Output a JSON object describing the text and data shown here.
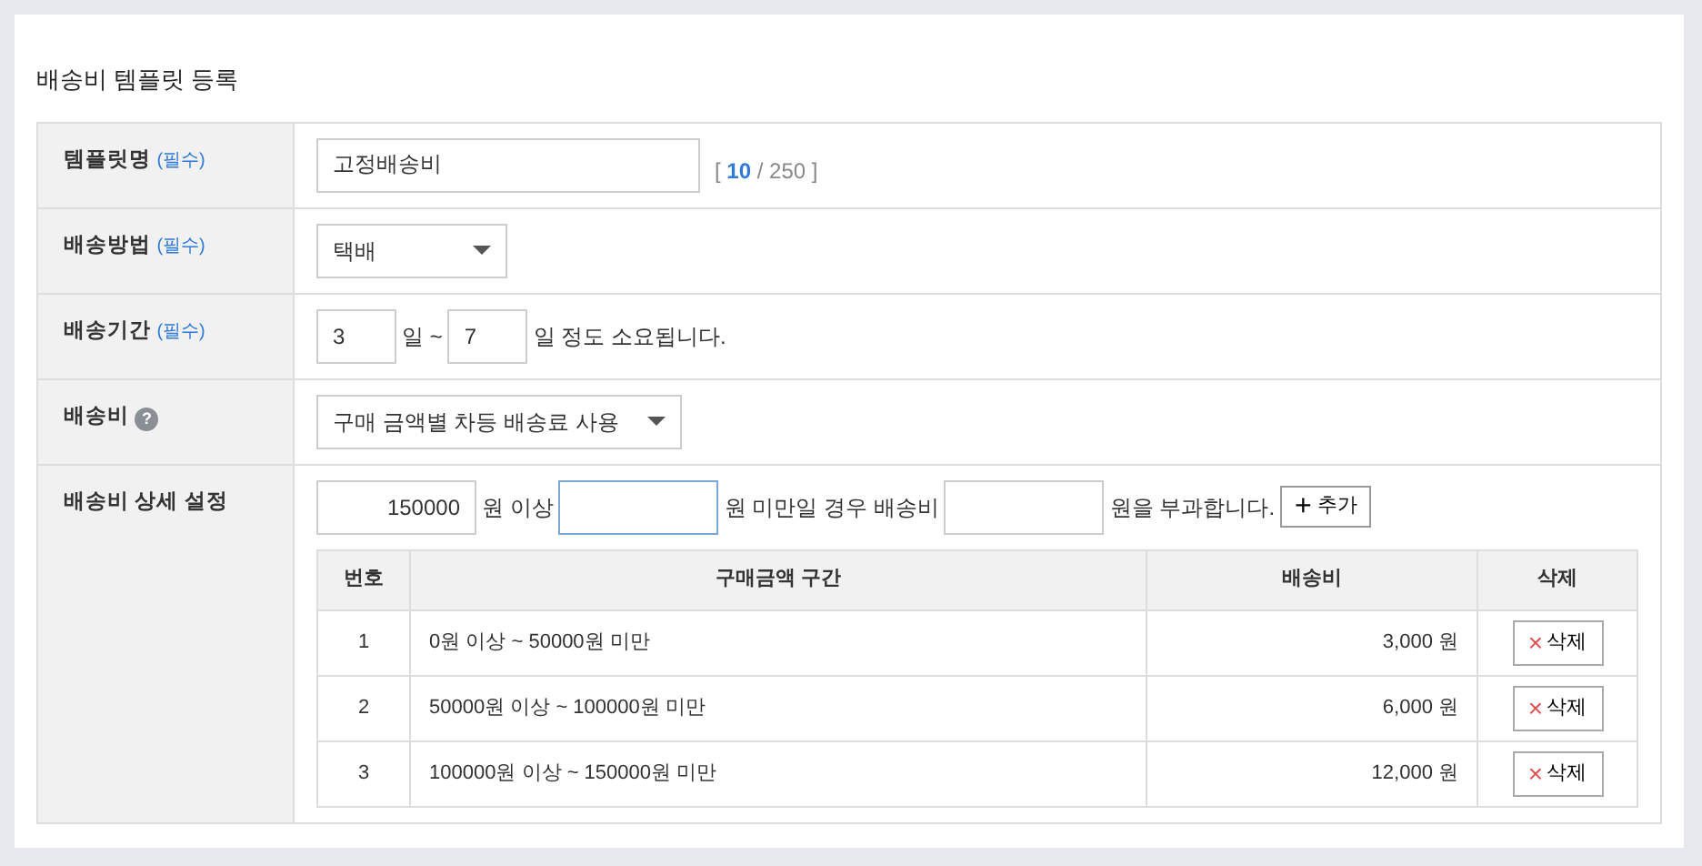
{
  "title": "배송비 템플릿 등록",
  "fields": [
    {
      "kind": "text",
      "label": "템플릿명",
      "required_tag": "(필수)",
      "value": "고정배송비",
      "counter": {
        "open": "[",
        "count": "10",
        "rest": "/ 250 ]"
      }
    },
    {
      "kind": "select",
      "label": "배송방법",
      "required_tag": "(필수)",
      "value": "택배",
      "wide": false
    },
    {
      "kind": "period",
      "label": "배송기간",
      "required_tag": "(필수)",
      "from": "3",
      "sep": "일 ~",
      "to": "7",
      "suffix": "일 정도 소요됩니다."
    },
    {
      "kind": "select",
      "label": "배송비",
      "help": "?",
      "value": "구매 금액별 차등 배송료 사용",
      "wide": true
    },
    {
      "kind": "tiers",
      "label": "배송비 상세 설정",
      "min": "150000",
      "text_1": "원 이상",
      "max_focused": true,
      "text_2": "원 미만일 경우 배송비",
      "text_3": "원을 부과합니다.",
      "add_icon": "+",
      "add_button": "추가",
      "table": {
        "columns": [
          "번호",
          "구매금액 구간",
          "배송비",
          "삭제"
        ],
        "rows": [
          {
            "no": "1",
            "range": "0원 이상 ~ 50000원 미만",
            "fee": "3,000 원",
            "delete_icon": "×",
            "delete": "삭제"
          },
          {
            "no": "2",
            "range": "50000원 이상 ~ 100000원 미만",
            "fee": "6,000 원",
            "delete_icon": "×",
            "delete": "삭제"
          },
          {
            "no": "3",
            "range": "100000원 이상 ~ 150000원 미만",
            "fee": "12,000 원",
            "delete_icon": "×",
            "delete": "삭제"
          }
        ]
      }
    }
  ]
}
